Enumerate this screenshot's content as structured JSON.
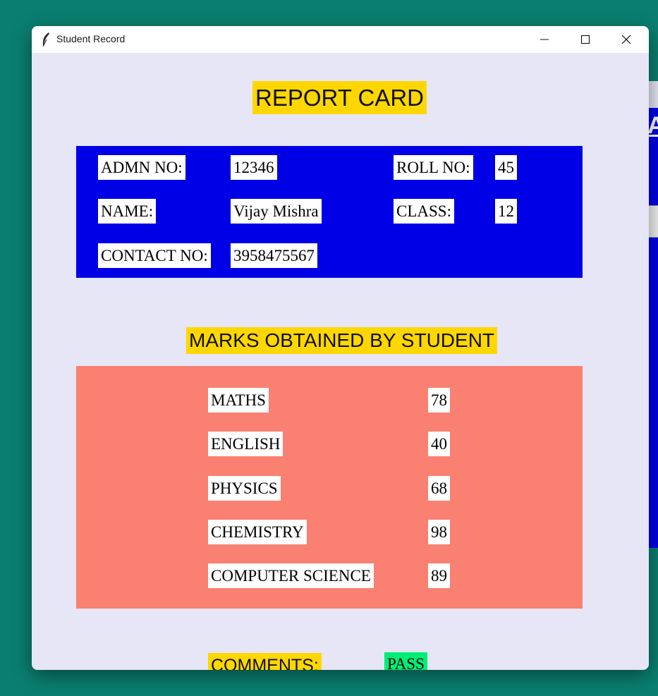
{
  "window": {
    "title": "Student Record"
  },
  "heading": "REPORT CARD",
  "student": {
    "admn_label": "ADMN NO:",
    "admn_value": "12346",
    "roll_label": "ROLL NO:",
    "roll_value": "45",
    "name_label": "NAME:",
    "name_value": "Vijay Mishra",
    "class_label": "CLASS:",
    "class_value": "12",
    "contact_label": "CONTACT NO:",
    "contact_value": "3958475567"
  },
  "marks_heading": "MARKS OBTAINED BY STUDENT",
  "marks": [
    {
      "subject": "MATHS",
      "score": "78"
    },
    {
      "subject": "ENGLISH",
      "score": "40"
    },
    {
      "subject": "PHYSICS",
      "score": "68"
    },
    {
      "subject": "CHEMISTRY",
      "score": "98"
    },
    {
      "subject": "COMPUTER SCIENCE",
      "score": "89"
    }
  ],
  "comments": {
    "label": "COMMENTS:",
    "value": "PASS"
  },
  "background_window": {
    "letter": "A"
  },
  "colors": {
    "window_bg": "#e6e6f6",
    "heading_bg": "#ffd700",
    "info_panel_bg": "#0000e6",
    "marks_panel_bg": "#fa8072",
    "pass_bg": "#00ee76",
    "desktop_bg": "#0a7f70"
  },
  "icons": {
    "app": "feather-icon",
    "minimize": "minimize-icon",
    "maximize": "maximize-icon",
    "close": "close-icon"
  }
}
